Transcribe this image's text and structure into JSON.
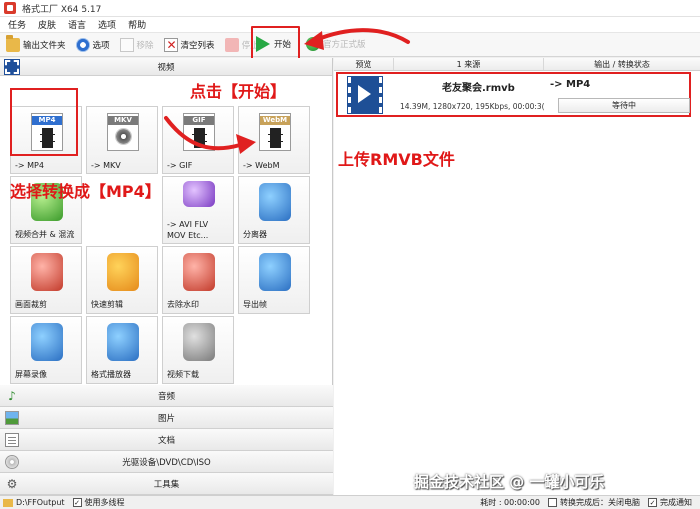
{
  "window": {
    "title": "格式工厂 X64 5.17"
  },
  "menu": [
    "任务",
    "皮肤",
    "语言",
    "选项",
    "帮助"
  ],
  "toolbar": {
    "output_folder": "输出文件夹",
    "options": "选项",
    "remove": "移除",
    "clear_list": "清空列表",
    "stop": "停止",
    "start": "开始",
    "official": "官方正式版"
  },
  "left": {
    "video_header": "视频",
    "tiles": [
      {
        "label": "-> MP4",
        "badge": "MP4",
        "color": "#2f6fcf"
      },
      {
        "label": "-> MKV",
        "badge": "MKV",
        "color": "#7a7a7a"
      },
      {
        "label": "-> GIF",
        "badge": "GIF",
        "color": "#7a7a7a"
      },
      {
        "label": "-> WebM",
        "badge": "WebM",
        "color": "#c8a25a"
      },
      {
        "label": "视频合并 & 混流"
      },
      {
        "label": "-> AVI FLV"
      },
      {
        "label": "分离器"
      },
      {
        "label": "画面裁剪"
      },
      {
        "label": "快速剪辑"
      },
      {
        "label": "去除水印"
      },
      {
        "label": "导出帧"
      },
      {
        "label": "屏幕录像"
      },
      {
        "label": "格式播放器"
      },
      {
        "label": "视频下载"
      }
    ],
    "avi_sub": "MOV Etc...",
    "categories": [
      "音频",
      "图片",
      "文档",
      "光驱设备\\DVD\\CD\\ISO",
      "工具集"
    ]
  },
  "right": {
    "columns": [
      "预览",
      "1 来源",
      "输出 / 转换状态"
    ],
    "task": {
      "name": "老友聚会.rmvb",
      "target": "-> MP4",
      "meta": "14.39M, 1280x720, 195Kbps, 00:00:3(",
      "status": "等待中"
    }
  },
  "status_bar": {
    "output_path": "D:\\FFOutput",
    "multithread": "使用多线程",
    "elapsed": "耗时 : 00:00:00",
    "shutdown": "转换完成后：关闭电脑",
    "notify": "完成通知"
  },
  "annotations": {
    "click_start": "点击【开始】",
    "upload": "上传RMVB文件",
    "select": "选择转换成【MP4】"
  },
  "watermark": "掘金技术社区 @ 一罐小可乐",
  "colors": {
    "annotation_red": "#e02020",
    "start_green": "#27a844"
  }
}
